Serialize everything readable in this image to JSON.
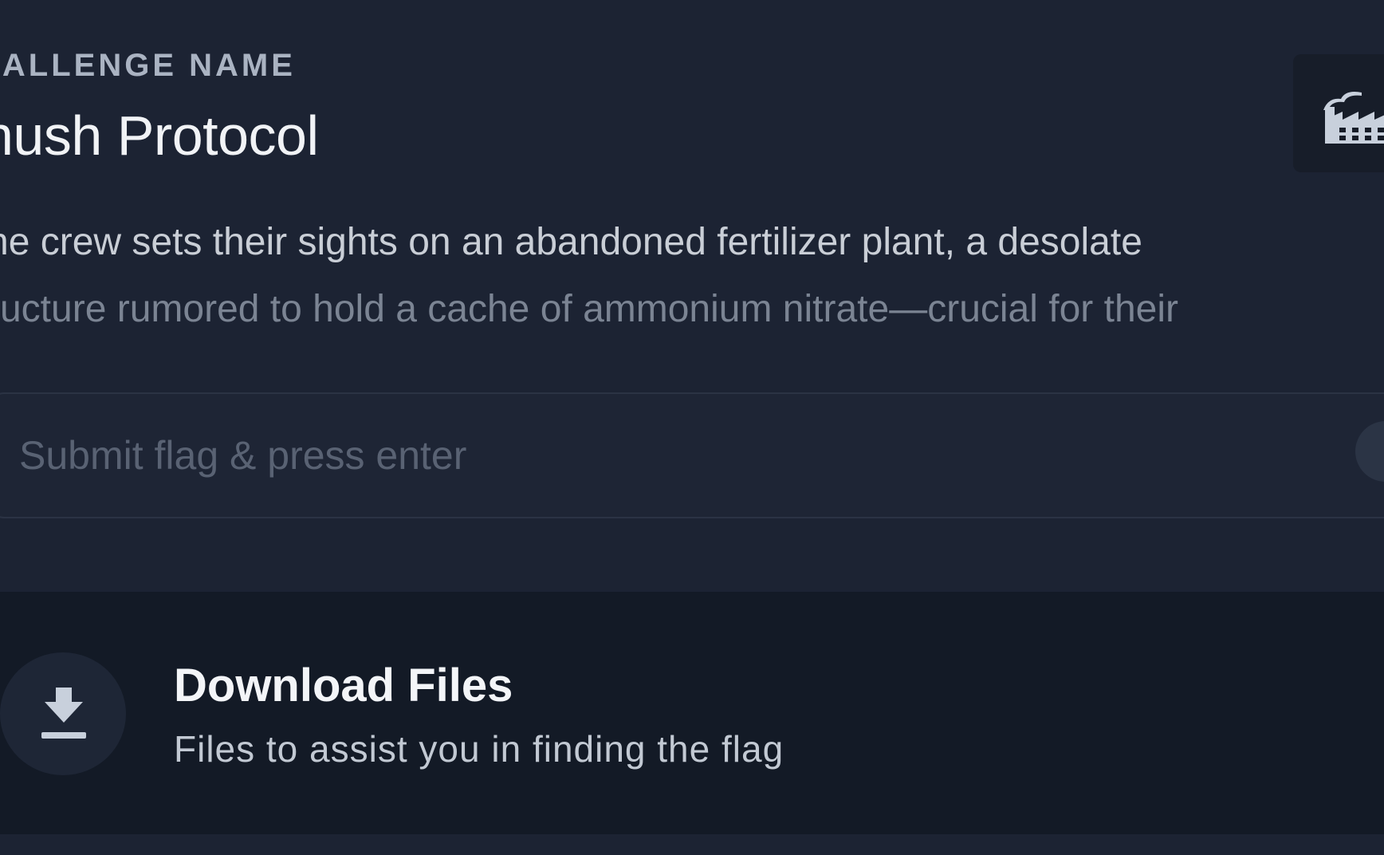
{
  "challenge": {
    "label": "HALLENGE NAME",
    "title": "hush Protocol",
    "description_line1": "he crew sets their sights on an abandoned fertilizer plant, a desolate",
    "description_line2": "ructure rumored to hold a cache of ammonium nitrate—crucial for their",
    "icon": "factory-icon"
  },
  "flag_input": {
    "placeholder": "Submit flag & press enter",
    "value": ""
  },
  "downloads": {
    "title": "Download Files",
    "subtitle": "Files to assist you in finding the flag",
    "icon": "download-icon"
  }
}
